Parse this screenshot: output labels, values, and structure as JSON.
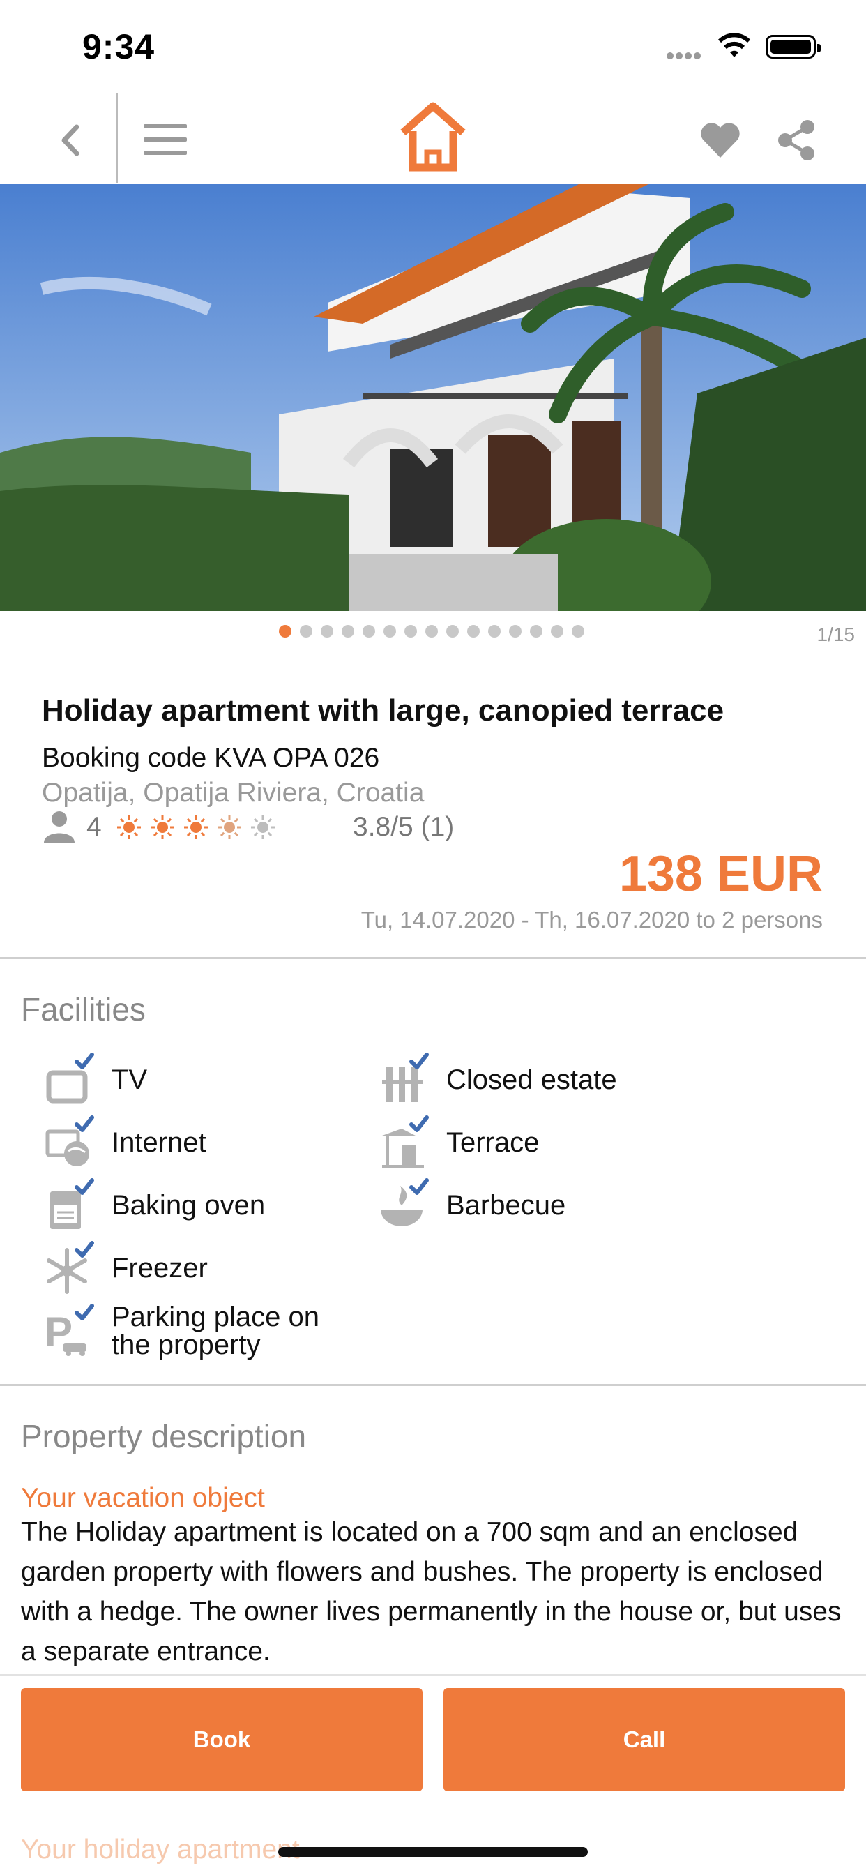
{
  "status_bar": {
    "time": "9:34"
  },
  "photo": {
    "counter": "1/15",
    "dot_count": 15,
    "active_dot": 0
  },
  "listing": {
    "title": "Holiday apartment with large, canopied terrace",
    "booking_code": "Booking code KVA OPA 026",
    "location": "Opatija, Opatija Riviera, Croatia",
    "guests": "4",
    "stars": 3.8,
    "rating": "3.8/5 (1)",
    "price": "138 EUR",
    "dates": "Tu, 14.07.2020 - Th, 16.07.2020 to 2 persons"
  },
  "facilities": {
    "heading": "Facilities",
    "items": [
      {
        "label": "TV",
        "icon": "tv-icon"
      },
      {
        "label": "Closed estate",
        "icon": "fence-icon"
      },
      {
        "label": "Internet",
        "icon": "internet-icon"
      },
      {
        "label": "Terrace",
        "icon": "terrace-icon"
      },
      {
        "label": "Baking oven",
        "icon": "oven-icon"
      },
      {
        "label": "Barbecue",
        "icon": "barbecue-icon"
      },
      {
        "label": "Freezer",
        "icon": "snowflake-icon"
      },
      {
        "label": "Parking place on the property",
        "icon": "parking-icon"
      }
    ]
  },
  "description": {
    "heading": "Property description",
    "subheading": "Your vacation object",
    "text": "The Holiday apartment is located on a 700 sqm and an enclosed garden property with flowers and bushes. The property is enclosed with a hedge. The owner lives permanently in the house or, but uses a separate entrance.",
    "next_heading": "Your holiday apartment"
  },
  "actions": {
    "book": "Book",
    "call": "Call"
  },
  "colors": {
    "accent": "#ef7a3b",
    "check": "#3f6bb0",
    "icon_gray": "#b3b3b3"
  }
}
